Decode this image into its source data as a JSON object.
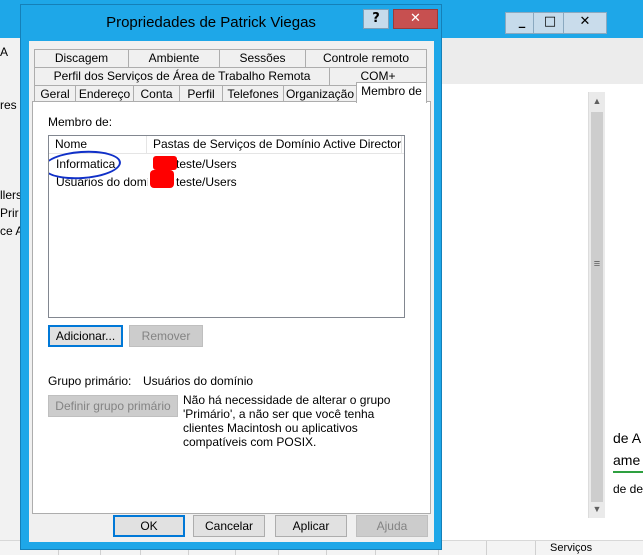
{
  "background": {
    "window_buttons": [
      "_",
      "□",
      "✕"
    ],
    "left_fragments": [
      "A",
      "res",
      "llers",
      "Prir",
      "ce A"
    ],
    "right_fragments": [
      "de A",
      "ame",
      "de de",
      "Serviços"
    ],
    "scroll_thumb_glyph": "≡"
  },
  "dialog": {
    "title": "Propriedades de Patrick Viegas",
    "help_label": "?",
    "close_label": "✕",
    "tabs_row1": [
      "Discagem",
      "Ambiente",
      "Sessões",
      "Controle remoto"
    ],
    "tabs_row2": [
      "Perfil dos Serviços de Área de Trabalho Remota",
      "COM+"
    ],
    "tabs_row3": [
      "Geral",
      "Endereço",
      "Conta",
      "Perfil",
      "Telefones",
      "Organização",
      "Membro de"
    ],
    "active_tab": "Membro de",
    "member_of_label": "Membro de:",
    "columns": [
      "Nome",
      "Pastas de Serviços de Domínio Active Directory"
    ],
    "rows": [
      {
        "name": "Informatica",
        "folder": "teste/Users"
      },
      {
        "name": "Usuários do domí...",
        "folder": "teste/Users"
      }
    ],
    "add_button": "Adicionar...",
    "remove_button": "Remover",
    "primary_group_label": "Grupo primário:",
    "primary_group_value": "Usuários do domínio",
    "set_primary_button": "Definir grupo primário",
    "info_text": "Não há necessidade de alterar o grupo 'Primário', a não ser que você tenha clientes Macintosh ou aplicativos compatíveis com POSIX.",
    "footer_buttons": {
      "ok": "OK",
      "cancel": "Cancelar",
      "apply": "Aplicar",
      "help": "Ajuda"
    }
  },
  "colors": {
    "titlebar": "#1ea7e8",
    "close": "#c75050",
    "annotation": "#1030c8",
    "redaction": "#ff0000"
  }
}
